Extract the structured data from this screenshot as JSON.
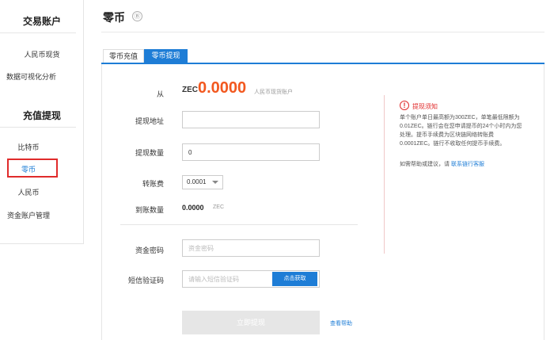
{
  "sidebar": {
    "section1_title": "交易账户",
    "section1_items": [
      "人民币现货",
      "数据可视化分析"
    ],
    "section2_title": "充值提现",
    "section2_items": [
      "比特币",
      "零币",
      "人民币"
    ],
    "section3_item": "资金账户管理"
  },
  "header": {
    "title": "零币",
    "coin_glyph": "Ⓑ"
  },
  "tabs": [
    {
      "label": "零币充值",
      "active": false
    },
    {
      "label": "零币提现",
      "active": true
    }
  ],
  "form": {
    "from_label": "从",
    "from_unit": "ZEC",
    "from_amount": "0.0000",
    "from_account": "人民币现货账户",
    "address_label": "提现地址",
    "address_value": "",
    "quantity_label": "提现数量",
    "quantity_value": "0",
    "fee_label": "转账费",
    "fee_selected": "0.0001",
    "received_label": "到账数量",
    "received_value": "0.0000",
    "received_unit": "ZEC",
    "password_label": "资金密码",
    "password_placeholder": "资金密码",
    "sms_label": "短信验证码",
    "sms_placeholder": "请输入短信验证码",
    "sms_button": "点击获取",
    "submit_label": "立即提现",
    "help_link": "查看帮助"
  },
  "notice": {
    "icon_glyph": "!",
    "title": "提现须知",
    "body": "单个账户单日最高额为300ZEC，单笔最低限额为0.01ZEC。链行会在您申请提币的24个小时内为您处理。提币手续费为区块链网络转账费0.0001ZEC。链行不收取任何提币手续费。",
    "help_prefix": "如需帮助或建议，请",
    "help_link": "联系链行客服"
  },
  "colors": {
    "accent": "#1e7dd6",
    "amount": "#f2581f",
    "alert": "#e02b2b"
  }
}
